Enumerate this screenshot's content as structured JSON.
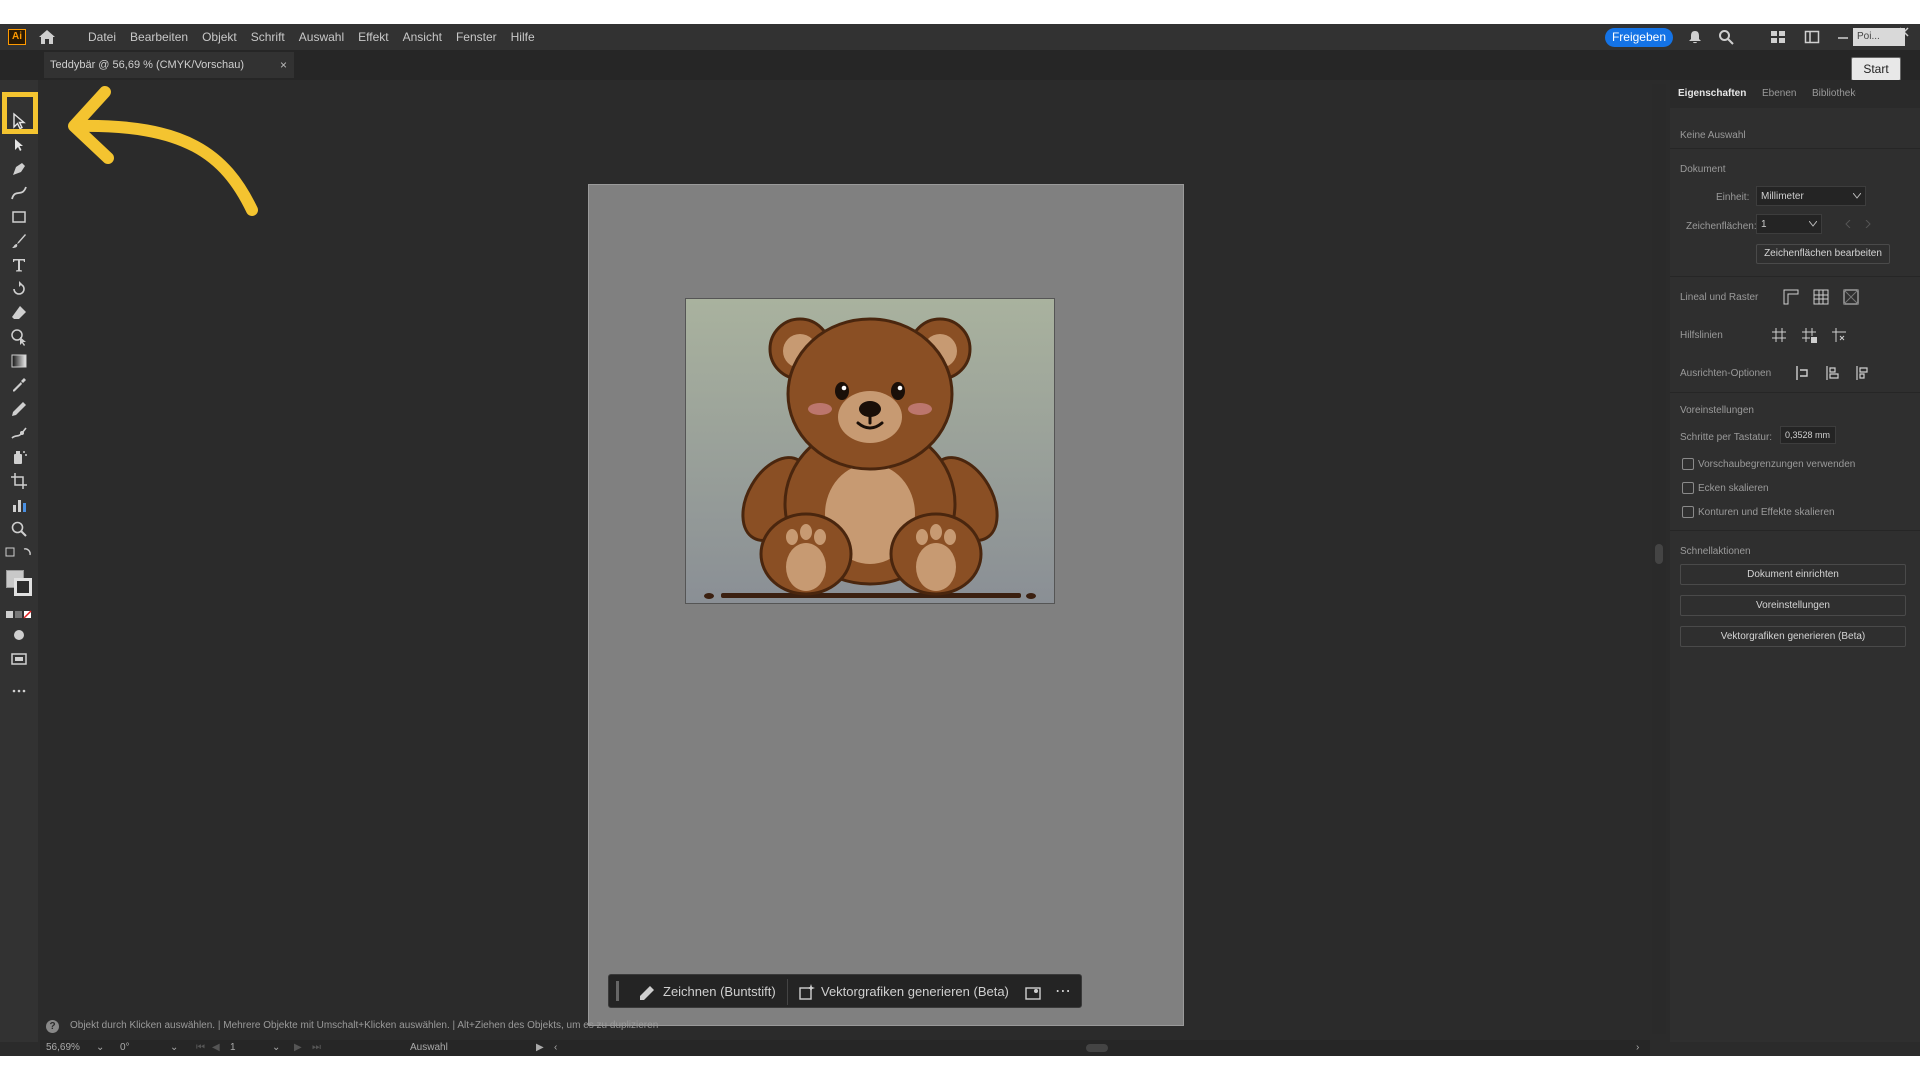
{
  "app": {
    "logo_text": "Ai",
    "menu": [
      "Datei",
      "Bearbeiten",
      "Objekt",
      "Schrift",
      "Auswahl",
      "Effekt",
      "Ansicht",
      "Fenster",
      "Hilfe"
    ],
    "share_label": "Freigeben",
    "accent_color": "#1473e6",
    "highlight_color": "#f4c430"
  },
  "tooltip": {
    "label": "Poi...",
    "start_label": "Start"
  },
  "document": {
    "tab_title": "Teddybär @ 56,69 % (CMYK/Vorschau)",
    "close": "×"
  },
  "contextbar": {
    "draw_label": "Zeichnen (Buntstift)",
    "generate_label": "Vektorgrafiken generieren (Beta)",
    "more": "⋯"
  },
  "panel": {
    "tabs": [
      "Eigenschaften",
      "Ebenen",
      "Bibliotheken"
    ],
    "no_selection": "Keine Auswahl",
    "document_heading": "Dokument",
    "unit_label": "Einheit:",
    "unit_value": "Millimeter",
    "artboards_label": "Zeichenflächen:",
    "artboards_value": "1",
    "edit_artboards": "Zeichenflächen bearbeiten",
    "rulers_grid": "Lineal und Raster",
    "guides": "Hilfslinien",
    "align_options": "Ausrichten-Optionen",
    "preferences_heading": "Voreinstellungen",
    "keyboard_increment_label": "Schritte per Tastatur:",
    "keyboard_increment_value": "0,3528 mm",
    "checkboxes": [
      "Vorschaubegrenzungen verwenden",
      "Ecken skalieren",
      "Konturen und Effekte skalieren"
    ],
    "quick_actions_heading": "Schnellaktionen",
    "quick_actions": [
      "Dokument einrichten",
      "Voreinstellungen",
      "Vektorgrafiken generieren (Beta)"
    ]
  },
  "status": {
    "hint": "Objekt durch Klicken auswählen.  |  Mehrere Objekte mit Umschalt+Klicken auswählen.  |  Alt+Ziehen des Objekts, um es zu duplizieren",
    "zoom": "56,69%",
    "rotation": "0°",
    "artboard_num": "1",
    "tool_name": "Auswahl"
  }
}
